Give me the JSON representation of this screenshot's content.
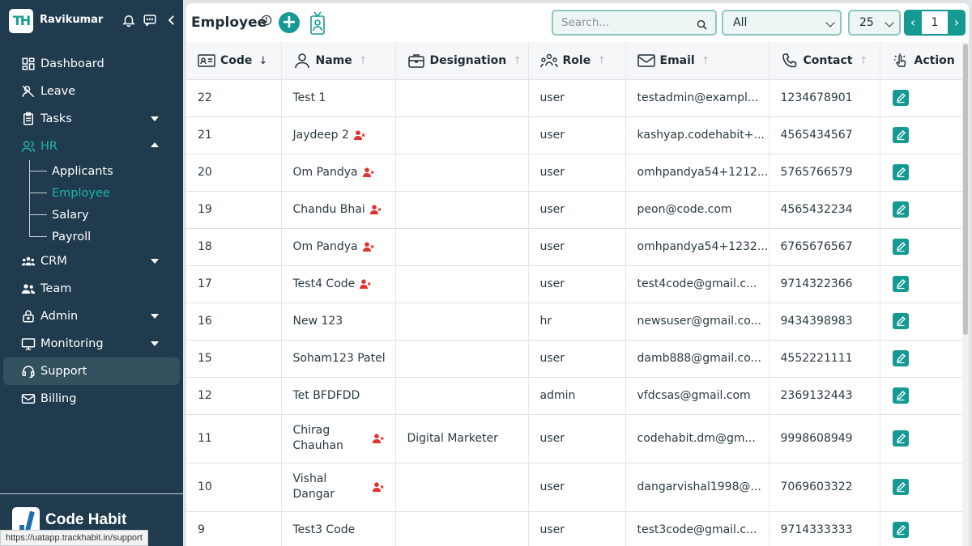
{
  "user": {
    "name": "Ravikumar",
    "logo_text": "TH"
  },
  "nav": {
    "dashboard": "Dashboard",
    "leave": "Leave",
    "tasks": "Tasks",
    "hr": "HR",
    "hr_sub": [
      "Applicants",
      "Employee",
      "Salary",
      "Payroll"
    ],
    "crm": "CRM",
    "team": "Team",
    "admin": "Admin",
    "monitoring": "Monitoring",
    "support": "Support",
    "billing": "Billing"
  },
  "brand": {
    "name": "Code Habit"
  },
  "status_url": "https://uatapp.trackhabit.in/support",
  "page": {
    "title": "Employee",
    "search_placeholder": "Search...",
    "filter_value": "All",
    "page_size": "25",
    "current_page": "1"
  },
  "columns": {
    "code": "Code",
    "name": "Name",
    "designation": "Designation",
    "role": "Role",
    "email": "Email",
    "contact": "Contact",
    "action": "Action"
  },
  "sort": {
    "code": "↓",
    "other": "↑"
  },
  "rows": [
    {
      "code": "22",
      "name": "Test 1",
      "inactive": false,
      "designation": "",
      "role": "user",
      "email": "testadmin@exampl...",
      "contact": "1234678901"
    },
    {
      "code": "21",
      "name": "Jaydeep 2",
      "inactive": true,
      "designation": "",
      "role": "user",
      "email": "kashyap.codehabit+...",
      "contact": "4565434567"
    },
    {
      "code": "20",
      "name": "Om Pandya",
      "inactive": true,
      "designation": "",
      "role": "user",
      "email": "omhpandya54+1212...",
      "contact": "5765766579"
    },
    {
      "code": "19",
      "name": "Chandu Bhai",
      "inactive": true,
      "designation": "",
      "role": "user",
      "email": "peon@code.com",
      "contact": "4565432234"
    },
    {
      "code": "18",
      "name": "Om Pandya",
      "inactive": true,
      "designation": "",
      "role": "user",
      "email": "omhpandya54+1232...",
      "contact": "6765676567"
    },
    {
      "code": "17",
      "name": "Test4 Code",
      "inactive": true,
      "designation": "",
      "role": "user",
      "email": "test4code@gmail.c...",
      "contact": "9714322366"
    },
    {
      "code": "16",
      "name": "New 123",
      "inactive": false,
      "designation": "",
      "role": "hr",
      "email": "newsuser@gmail.co...",
      "contact": "9434398983"
    },
    {
      "code": "15",
      "name": "Soham123 Patel",
      "inactive": false,
      "designation": "",
      "role": "user",
      "email": "damb888@gmail.co...",
      "contact": "4552221111"
    },
    {
      "code": "12",
      "name": "Tet BFDFDD",
      "inactive": false,
      "designation": "",
      "role": "admin",
      "email": "vfdcsas@gmail.com",
      "contact": "2369132443"
    },
    {
      "code": "11",
      "name": "Chirag Chauhan",
      "inactive": true,
      "designation": "Digital Marketer",
      "role": "user",
      "email": "codehabit.dm@gm...",
      "contact": "9998608949",
      "tall": true
    },
    {
      "code": "10",
      "name": "Vishal Dangar",
      "inactive": true,
      "designation": "",
      "role": "user",
      "email": "dangarvishal1998@...",
      "contact": "7069603322",
      "tall": true
    },
    {
      "code": "9",
      "name": "Test3 Code",
      "inactive": false,
      "designation": "",
      "role": "user",
      "email": "test3code@gmail.c...",
      "contact": "9714333333"
    }
  ],
  "colors": {
    "sidebar": "#1f3b4d",
    "accent": "#159a93",
    "active_text": "#1fb5ad",
    "inactive_user": "#e0332e"
  }
}
